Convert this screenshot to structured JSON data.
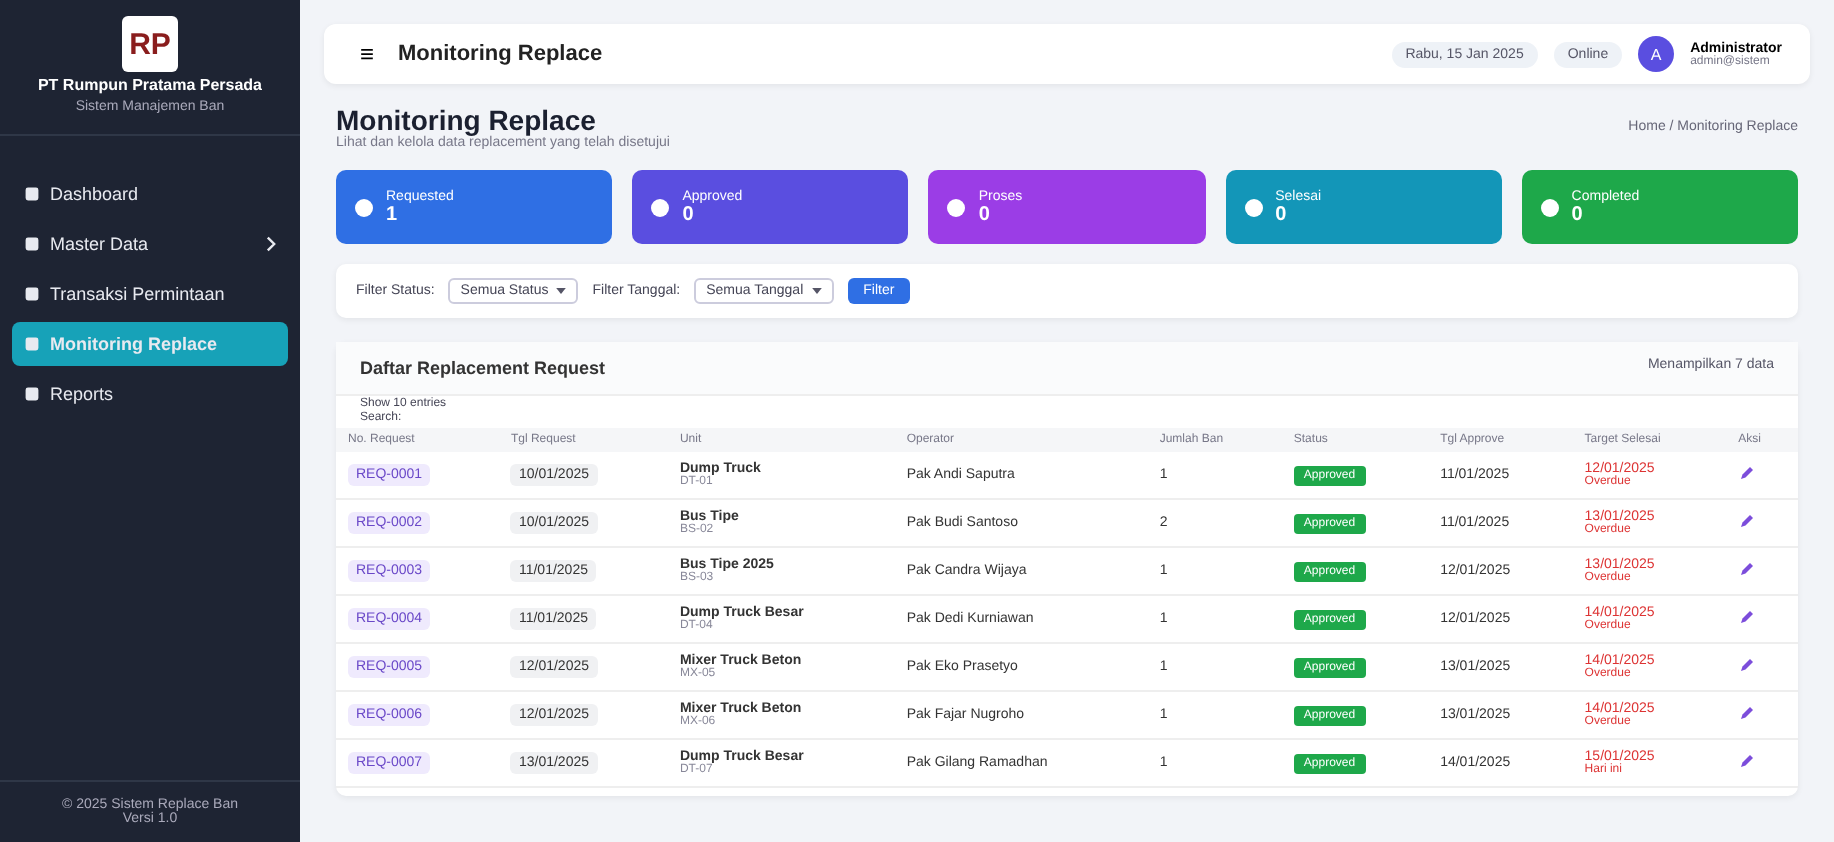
{
  "sidebar": {
    "logo": "RP",
    "company": "PT Rumpun Pratama Persada",
    "tagline": "Sistem Manajemen Ban",
    "items": [
      {
        "label": "Dashboard",
        "selected": false,
        "has_submenu": false
      },
      {
        "label": "Master Data",
        "selected": false,
        "has_submenu": true
      },
      {
        "label": "Transaksi Permintaan",
        "selected": false,
        "has_submenu": false
      },
      {
        "label": "Monitoring Replace",
        "selected": true,
        "has_submenu": false
      },
      {
        "label": "Reports",
        "selected": false,
        "has_submenu": false
      }
    ],
    "footer": [
      "© 2025 Sistem Replace Ban",
      "Versi 1.0"
    ]
  },
  "topbar": {
    "menu_glyph": "≡",
    "title": "Monitoring Replace",
    "date": "Rabu, 15 Jan 2025",
    "status": "Online",
    "user_initial": "A",
    "user_name": "Administrator",
    "user_role": "admin@sistem"
  },
  "header": {
    "title": "Monitoring Replace",
    "subtitle": "Lihat dan kelola data replacement yang telah disetujui",
    "breadcrumb": "Home / Monitoring Replace"
  },
  "stats": [
    {
      "label": "Requested",
      "value": "1",
      "color": "#2f6fe4"
    },
    {
      "label": "Approved",
      "value": "0",
      "color": "#5a4ee0"
    },
    {
      "label": "Proses",
      "value": "0",
      "color": "#9b3de6"
    },
    {
      "label": "Selesai",
      "value": "0",
      "color": "#1396b8"
    },
    {
      "label": "Completed",
      "value": "0",
      "color": "#1ea84a"
    }
  ],
  "filter": {
    "status_label": "Filter Status:",
    "status_value": "Semua Status",
    "date_label": "Filter Tanggal:",
    "date_value": "Semua Tanggal",
    "button": "Filter"
  },
  "table": {
    "title": "Daftar Replacement Request",
    "count": "Menampilkan 7 data",
    "show": "Show 10 entries",
    "search": "Search:",
    "columns": [
      "No. Request",
      "Tgl Request",
      "Unit",
      "Operator",
      "Jumlah Ban",
      "Status",
      "Tgl Approve",
      "Target Selesai",
      "Aksi"
    ],
    "rows": [
      {
        "no": "REQ-0001",
        "date": "10/01/2025",
        "unit": "Dump Truck",
        "unit_code": "DT-01",
        "operator": "Pak Andi Saputra",
        "qty": "1",
        "status": "Approved",
        "approve": "11/01/2025",
        "target": "12/01/2025",
        "target_note": "Overdue"
      },
      {
        "no": "REQ-0002",
        "date": "10/01/2025",
        "unit": "Bus Tipe",
        "unit_code": "BS-02",
        "operator": "Pak Budi Santoso",
        "qty": "2",
        "status": "Approved",
        "approve": "11/01/2025",
        "target": "13/01/2025",
        "target_note": "Overdue"
      },
      {
        "no": "REQ-0003",
        "date": "11/01/2025",
        "unit": "Bus Tipe 2025",
        "unit_code": "BS-03",
        "operator": "Pak Candra Wijaya",
        "qty": "1",
        "status": "Approved",
        "approve": "12/01/2025",
        "target": "13/01/2025",
        "target_note": "Overdue"
      },
      {
        "no": "REQ-0004",
        "date": "11/01/2025",
        "unit": "Dump Truck Besar",
        "unit_code": "DT-04",
        "operator": "Pak Dedi Kurniawan",
        "qty": "1",
        "status": "Approved",
        "approve": "12/01/2025",
        "target": "14/01/2025",
        "target_note": "Overdue"
      },
      {
        "no": "REQ-0005",
        "date": "12/01/2025",
        "unit": "Mixer Truck Beton",
        "unit_code": "MX-05",
        "operator": "Pak Eko Prasetyo",
        "qty": "1",
        "status": "Approved",
        "approve": "13/01/2025",
        "target": "14/01/2025",
        "target_note": "Overdue"
      },
      {
        "no": "REQ-0006",
        "date": "12/01/2025",
        "unit": "Mixer Truck Beton",
        "unit_code": "MX-06",
        "operator": "Pak Fajar Nugroho",
        "qty": "1",
        "status": "Approved",
        "approve": "13/01/2025",
        "target": "14/01/2025",
        "target_note": "Overdue"
      },
      {
        "no": "REQ-0007",
        "date": "13/01/2025",
        "unit": "Dump Truck Besar",
        "unit_code": "DT-07",
        "operator": "Pak Gilang Ramadhan",
        "qty": "1",
        "status": "Approved",
        "approve": "14/01/2025",
        "target": "15/01/2025",
        "target_note": "Hari ini"
      }
    ]
  }
}
